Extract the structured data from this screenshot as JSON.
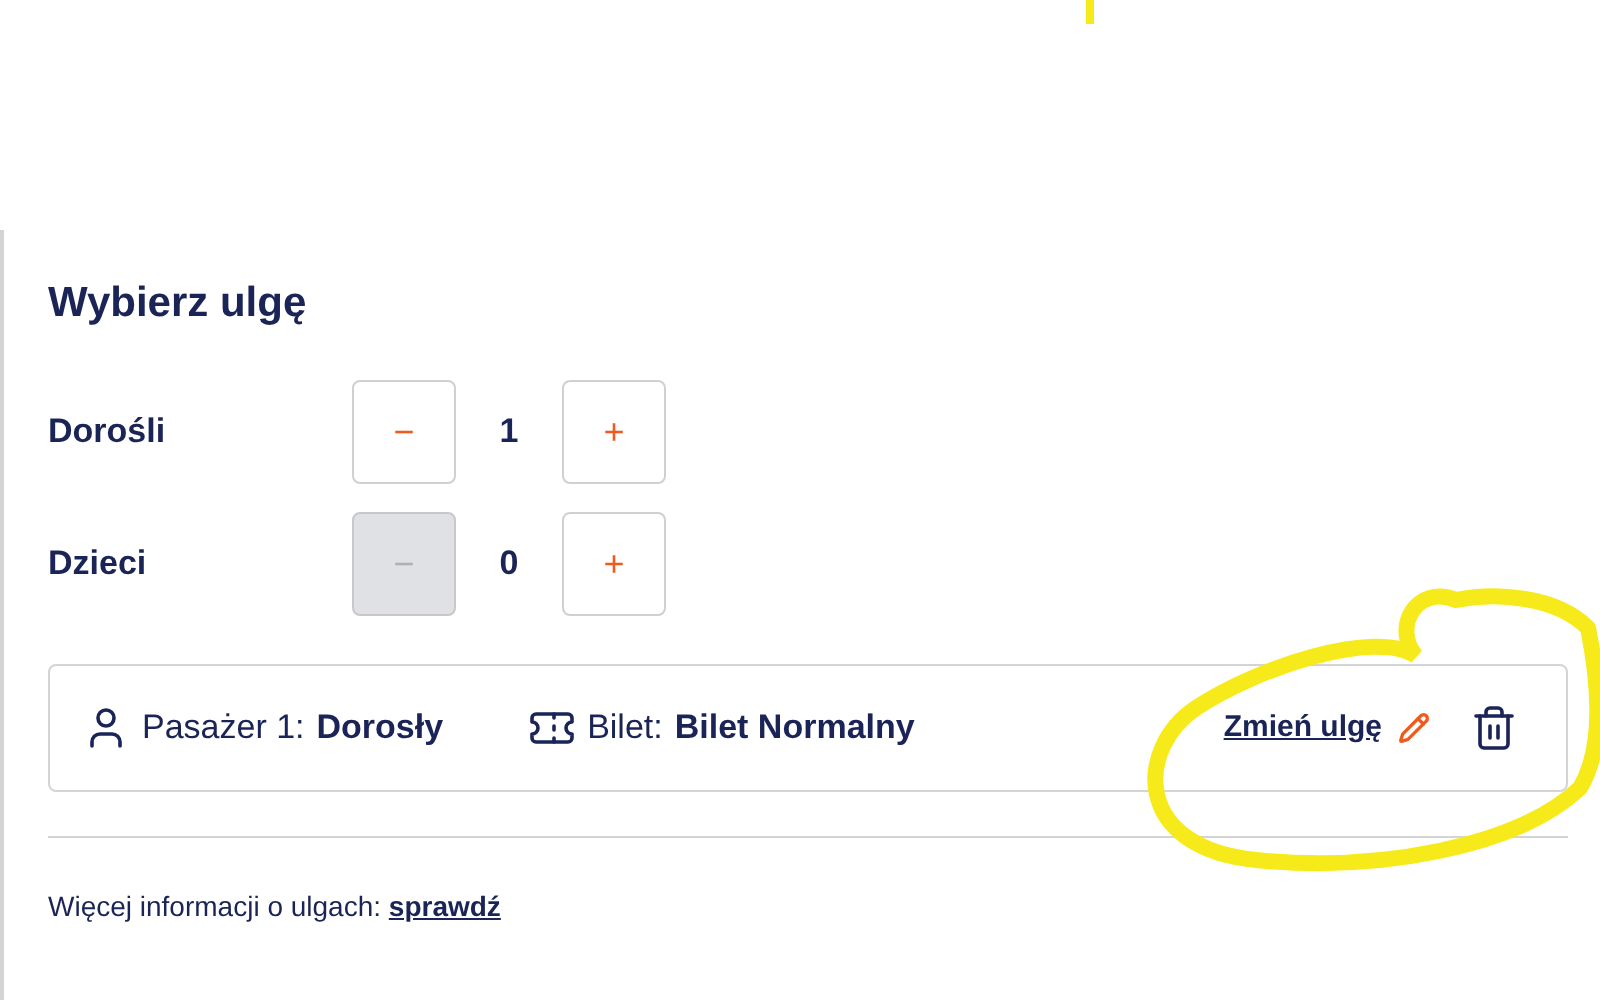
{
  "title": "Wybierz ulgę",
  "counters": [
    {
      "label": "Dorośli",
      "value": "1",
      "minus": "−",
      "plus": "+",
      "minus_disabled": false
    },
    {
      "label": "Dzieci",
      "value": "0",
      "minus": "−",
      "plus": "+",
      "minus_disabled": true
    }
  ],
  "passenger": {
    "label": "Pasażer 1:",
    "type": "Dorosły",
    "ticket_label": "Bilet:",
    "ticket": "Bilet Normalny",
    "change_link": "Zmień ulgę"
  },
  "footer": {
    "text": "Więcej informacji o ulgach:",
    "link": "sprawdź"
  }
}
